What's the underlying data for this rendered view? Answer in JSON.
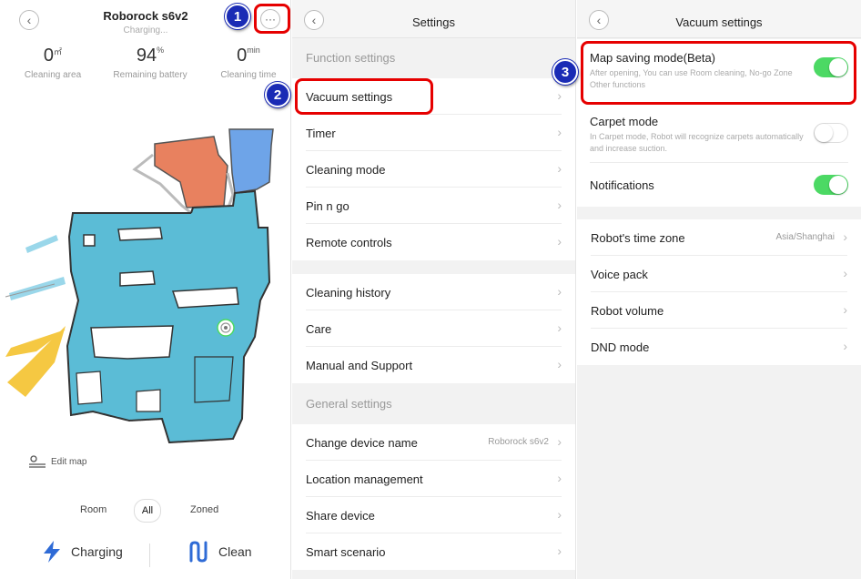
{
  "panel1": {
    "title": "Roborock s6v2",
    "status": "Charging...",
    "more_label": "···",
    "stats": [
      {
        "value": "0",
        "unit": "㎡",
        "label": "Cleaning area"
      },
      {
        "value": "94",
        "unit": "%",
        "label": "Remaining battery"
      },
      {
        "value": "0",
        "unit": "min",
        "label": "Cleaning time"
      }
    ],
    "edit_map": "Edit map",
    "modes": [
      "Room",
      "All",
      "Zoned"
    ],
    "active_mode": "All",
    "actions": {
      "charging": "Charging",
      "clean": "Clean"
    }
  },
  "panel2": {
    "title": "Settings",
    "function_title": "Function settings",
    "function_items": [
      "Vacuum settings",
      "Timer",
      "Cleaning mode",
      "Pin n go",
      "Remote controls"
    ],
    "misc_items": [
      "Cleaning history",
      "Care",
      "Manual and Support"
    ],
    "general_title": "General settings",
    "general_items": [
      {
        "label": "Change device name",
        "value": "Roborock s6v2"
      },
      {
        "label": "Location management",
        "value": ""
      },
      {
        "label": "Share device",
        "value": ""
      },
      {
        "label": "Smart scenario",
        "value": ""
      }
    ]
  },
  "panel3": {
    "title": "Vacuum settings",
    "toggles": [
      {
        "label": "Map saving mode(Beta)",
        "desc": "After opening, You can use Room cleaning, No-go Zone Other functions",
        "on": true
      },
      {
        "label": "Carpet mode",
        "desc": "In Carpet mode, Robot will recognize carpets automatically and increase suction.",
        "on": false
      },
      {
        "label": "Notifications",
        "desc": "",
        "on": true
      }
    ],
    "items": [
      {
        "label": "Robot's time zone",
        "value": "Asia/Shanghai"
      },
      {
        "label": "Voice pack",
        "value": ""
      },
      {
        "label": "Robot volume",
        "value": ""
      },
      {
        "label": "DND mode",
        "value": ""
      }
    ]
  },
  "annotations": [
    "1",
    "2",
    "3"
  ],
  "colors": {
    "toggle_on": "#4cd964",
    "highlight": "#e60000",
    "badge": "#1a2bb5",
    "map_floor": "#5bbcd6",
    "accent_blue": "#2f6bd6"
  }
}
